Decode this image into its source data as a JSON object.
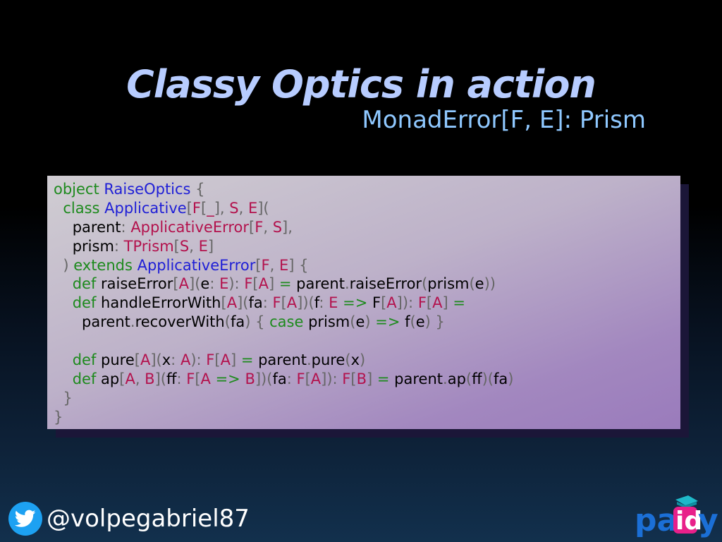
{
  "slide": {
    "title": "Classy Optics in action",
    "subtitle": "MonadError[F, E]: Prism"
  },
  "code": {
    "lines": [
      [
        [
          "kw",
          "object "
        ],
        [
          "ty",
          "RaiseOptics"
        ],
        [
          "pn",
          " {"
        ]
      ],
      [
        [
          "",
          "  "
        ],
        [
          "kw",
          "class "
        ],
        [
          "ty",
          "Applicative"
        ],
        [
          "pn",
          "["
        ],
        [
          "tp",
          "F"
        ],
        [
          "pn",
          "["
        ],
        [
          "tp",
          "_"
        ],
        [
          "pn",
          "], "
        ],
        [
          "tp",
          "S"
        ],
        [
          "pn",
          ", "
        ],
        [
          "tp",
          "E"
        ],
        [
          "pn",
          "]("
        ]
      ],
      [
        [
          "",
          "    parent"
        ],
        [
          "pn",
          ": "
        ],
        [
          "tp",
          "ApplicativeError"
        ],
        [
          "pn",
          "["
        ],
        [
          "tp",
          "F"
        ],
        [
          "pn",
          ", "
        ],
        [
          "tp",
          "S"
        ],
        [
          "pn",
          "],"
        ]
      ],
      [
        [
          "",
          "    prism"
        ],
        [
          "pn",
          ": "
        ],
        [
          "tp",
          "TPrism"
        ],
        [
          "pn",
          "["
        ],
        [
          "tp",
          "S"
        ],
        [
          "pn",
          ", "
        ],
        [
          "tp",
          "E"
        ],
        [
          "pn",
          "]"
        ]
      ],
      [
        [
          "pn",
          "  ) "
        ],
        [
          "kw",
          "extends "
        ],
        [
          "ty",
          "ApplicativeError"
        ],
        [
          "pn",
          "["
        ],
        [
          "tp",
          "F"
        ],
        [
          "pn",
          ", "
        ],
        [
          "tp",
          "E"
        ],
        [
          "pn",
          "] {"
        ]
      ],
      [
        [
          "",
          "    "
        ],
        [
          "kw",
          "def "
        ],
        [
          "",
          "raiseError"
        ],
        [
          "pn",
          "["
        ],
        [
          "tp",
          "A"
        ],
        [
          "pn",
          "]("
        ],
        [
          "",
          "e"
        ],
        [
          "pn",
          ": "
        ],
        [
          "tp",
          "E"
        ],
        [
          "pn",
          "): "
        ],
        [
          "tp",
          "F"
        ],
        [
          "pn",
          "["
        ],
        [
          "tp",
          "A"
        ],
        [
          "pn",
          "] "
        ],
        [
          "op",
          "="
        ],
        [
          "",
          " parent"
        ],
        [
          "pn",
          "."
        ],
        [
          "",
          "raiseError"
        ],
        [
          "pn",
          "("
        ],
        [
          "",
          "prism"
        ],
        [
          "pn",
          "("
        ],
        [
          "",
          "e"
        ],
        [
          "pn",
          "))"
        ]
      ],
      [
        [
          "",
          "    "
        ],
        [
          "kw",
          "def "
        ],
        [
          "",
          "handleErrorWith"
        ],
        [
          "pn",
          "["
        ],
        [
          "tp",
          "A"
        ],
        [
          "pn",
          "]("
        ],
        [
          "",
          "fa"
        ],
        [
          "pn",
          ": "
        ],
        [
          "tp",
          "F"
        ],
        [
          "pn",
          "["
        ],
        [
          "tp",
          "A"
        ],
        [
          "pn",
          "])("
        ],
        [
          "",
          "f"
        ],
        [
          "pn",
          ": "
        ],
        [
          "tp",
          "E"
        ],
        [
          "op",
          " => "
        ],
        [
          "",
          "F"
        ],
        [
          "pn",
          "["
        ],
        [
          "tp",
          "A"
        ],
        [
          "pn",
          "]): "
        ],
        [
          "tp",
          "F"
        ],
        [
          "pn",
          "["
        ],
        [
          "tp",
          "A"
        ],
        [
          "pn",
          "] "
        ],
        [
          "op",
          "="
        ]
      ],
      [
        [
          "",
          "      parent"
        ],
        [
          "pn",
          "."
        ],
        [
          "",
          "recoverWith"
        ],
        [
          "pn",
          "("
        ],
        [
          "",
          "fa"
        ],
        [
          "pn",
          ") { "
        ],
        [
          "kw",
          "case "
        ],
        [
          "",
          "prism"
        ],
        [
          "pn",
          "("
        ],
        [
          "",
          "e"
        ],
        [
          "pn",
          ") "
        ],
        [
          "op",
          "=> "
        ],
        [
          "",
          "f"
        ],
        [
          "pn",
          "("
        ],
        [
          "",
          "e"
        ],
        [
          "pn",
          ") }"
        ]
      ],
      [
        [
          "",
          ""
        ]
      ],
      [
        [
          "",
          "    "
        ],
        [
          "kw",
          "def "
        ],
        [
          "",
          "pure"
        ],
        [
          "pn",
          "["
        ],
        [
          "tp",
          "A"
        ],
        [
          "pn",
          "]("
        ],
        [
          "",
          "x"
        ],
        [
          "pn",
          ": "
        ],
        [
          "tp",
          "A"
        ],
        [
          "pn",
          "): "
        ],
        [
          "tp",
          "F"
        ],
        [
          "pn",
          "["
        ],
        [
          "tp",
          "A"
        ],
        [
          "pn",
          "] "
        ],
        [
          "op",
          "="
        ],
        [
          "",
          " parent"
        ],
        [
          "pn",
          "."
        ],
        [
          "",
          "pure"
        ],
        [
          "pn",
          "("
        ],
        [
          "",
          "x"
        ],
        [
          "pn",
          ")"
        ]
      ],
      [
        [
          "",
          "    "
        ],
        [
          "kw",
          "def "
        ],
        [
          "",
          "ap"
        ],
        [
          "pn",
          "["
        ],
        [
          "tp",
          "A"
        ],
        [
          "pn",
          ", "
        ],
        [
          "tp",
          "B"
        ],
        [
          "pn",
          "]("
        ],
        [
          "",
          "ff"
        ],
        [
          "pn",
          ": "
        ],
        [
          "tp",
          "F"
        ],
        [
          "pn",
          "["
        ],
        [
          "tp",
          "A"
        ],
        [
          "op",
          " => "
        ],
        [
          "tp",
          "B"
        ],
        [
          "pn",
          "])("
        ],
        [
          "",
          "fa"
        ],
        [
          "pn",
          ": "
        ],
        [
          "tp",
          "F"
        ],
        [
          "pn",
          "["
        ],
        [
          "tp",
          "A"
        ],
        [
          "pn",
          "]): "
        ],
        [
          "tp",
          "F"
        ],
        [
          "pn",
          "["
        ],
        [
          "tp",
          "B"
        ],
        [
          "pn",
          "] "
        ],
        [
          "op",
          "="
        ],
        [
          "",
          " parent"
        ],
        [
          "pn",
          "."
        ],
        [
          "",
          "ap"
        ],
        [
          "pn",
          "("
        ],
        [
          "",
          "ff"
        ],
        [
          "pn",
          ")("
        ],
        [
          "",
          "fa"
        ],
        [
          "pn",
          ")"
        ]
      ],
      [
        [
          "pn",
          "  }"
        ]
      ],
      [
        [
          "pn",
          "}"
        ]
      ]
    ]
  },
  "footer": {
    "handle": "@volpegabriel87",
    "twitter_icon": "twitter-bird-icon",
    "twitter_color": "#1da1f2",
    "logo_text": "paidy",
    "logo_colors": {
      "primary": "#1b6fd6",
      "accent": "#e8208a",
      "cap": "#1fb9c9"
    }
  }
}
